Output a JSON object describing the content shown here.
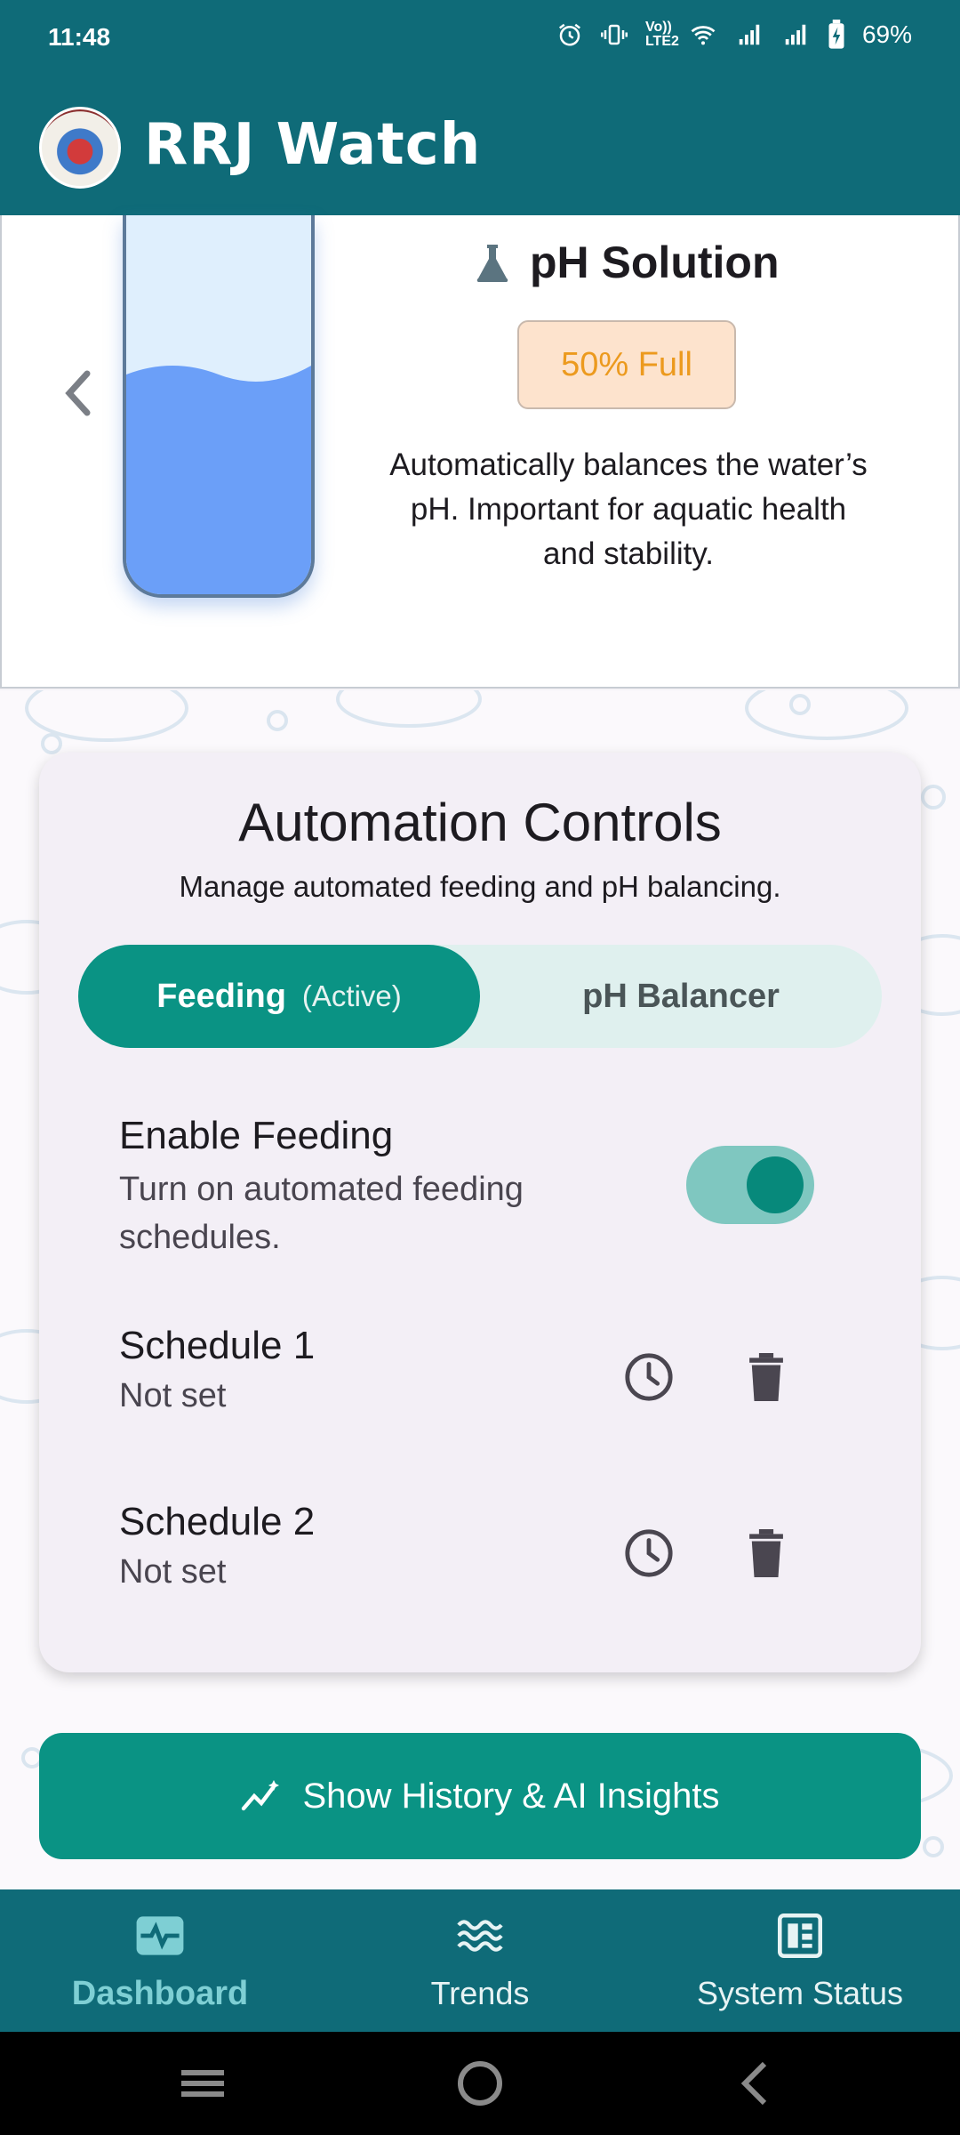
{
  "status_bar": {
    "time": "11:48",
    "volte_label": "Vo)) LTE2",
    "battery": "69%"
  },
  "app_bar": {
    "title": "RRJ Watch",
    "logo_icon": "aquarium-logo-icon"
  },
  "tank_card": {
    "title": "pH Solution",
    "title_icon": "flask-icon",
    "fill_percent": 50,
    "fill_label": "50% Full",
    "description": "Automatically balances the water’s pH. Important for aquatic health and stability.",
    "prev_icon": "chevron-left-icon"
  },
  "automation": {
    "title": "Automation Controls",
    "subtitle": "Manage automated feeding and pH balancing.",
    "tabs": [
      {
        "label": "Feeding",
        "status": "(Active)",
        "selected": true
      },
      {
        "label": "pH Balancer",
        "selected": false
      }
    ],
    "enable": {
      "title": "Enable Feeding",
      "description": "Turn on automated feeding schedules.",
      "on": true
    },
    "schedules": [
      {
        "title": "Schedule 1",
        "value": "Not set"
      },
      {
        "title": "Schedule 2",
        "value": "Not set"
      }
    ]
  },
  "history_button": {
    "label": "Show History & AI Insights",
    "icon": "sparkle-chart-icon"
  },
  "bottom_nav": [
    {
      "label": "Dashboard",
      "icon": "pulse-icon",
      "active": true
    },
    {
      "label": "Trends",
      "icon": "waves-icon",
      "active": false
    },
    {
      "label": "System Status",
      "icon": "grid-status-icon",
      "active": false
    }
  ],
  "colors": {
    "primary": "#0f6b78",
    "accent": "#0a9384",
    "badge_text": "#ec9a1e",
    "water": "#6b9ff8"
  }
}
